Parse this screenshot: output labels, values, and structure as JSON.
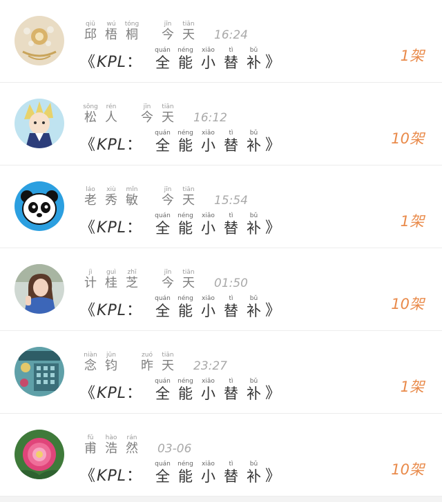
{
  "items": [
    {
      "name": [
        {
          "py": "qiū",
          "hz": "邱"
        },
        {
          "py": "wú",
          "hz": "梧"
        },
        {
          "py": "tóng",
          "hz": "桐"
        }
      ],
      "day": [
        {
          "py": "jīn",
          "hz": "今"
        },
        {
          "py": "tiān",
          "hz": "天"
        }
      ],
      "time": "16:24",
      "count": "1架",
      "avatar": "brooch"
    },
    {
      "name": [
        {
          "py": "sōng",
          "hz": "松"
        },
        {
          "py": "rén",
          "hz": "人"
        }
      ],
      "day": [
        {
          "py": "jīn",
          "hz": "今"
        },
        {
          "py": "tiān",
          "hz": "天"
        }
      ],
      "time": "16:12",
      "count": "10架",
      "avatar": "anime"
    },
    {
      "name": [
        {
          "py": "láo",
          "hz": "老"
        },
        {
          "py": "xiù",
          "hz": "秀"
        },
        {
          "py": "mǐn",
          "hz": "敏"
        }
      ],
      "day": [
        {
          "py": "jīn",
          "hz": "今"
        },
        {
          "py": "tiān",
          "hz": "天"
        }
      ],
      "time": "15:54",
      "count": "1架",
      "avatar": "panda"
    },
    {
      "name": [
        {
          "py": "jì",
          "hz": "计"
        },
        {
          "py": "guì",
          "hz": "桂"
        },
        {
          "py": "zhī",
          "hz": "芝"
        }
      ],
      "day": [
        {
          "py": "jīn",
          "hz": "今"
        },
        {
          "py": "tiān",
          "hz": "天"
        }
      ],
      "time": "01:50",
      "count": "10架",
      "avatar": "girl"
    },
    {
      "name": [
        {
          "py": "niàn",
          "hz": "念"
        },
        {
          "py": "jūn",
          "hz": "钧"
        }
      ],
      "day": [
        {
          "py": "zuó",
          "hz": "昨"
        },
        {
          "py": "tiān",
          "hz": "天"
        }
      ],
      "time": "23:27",
      "count": "1架",
      "avatar": "game"
    },
    {
      "name": [
        {
          "py": "fǔ",
          "hz": "甫"
        },
        {
          "py": "hào",
          "hz": "浩"
        },
        {
          "py": "rán",
          "hz": "然"
        }
      ],
      "day": [],
      "time": "03-06",
      "count": "10架",
      "avatar": "peony"
    }
  ],
  "title": {
    "open": "《",
    "prefix": "KPL",
    "colon": "：",
    "close": "》",
    "chars": [
      {
        "py": "quán",
        "hz": "全"
      },
      {
        "py": "néng",
        "hz": "能"
      },
      {
        "py": "xiǎo",
        "hz": "小"
      },
      {
        "py": "tì",
        "hz": "替"
      },
      {
        "py": "bǔ",
        "hz": "补"
      }
    ]
  },
  "colors": {
    "accent": "#e98a4a"
  }
}
